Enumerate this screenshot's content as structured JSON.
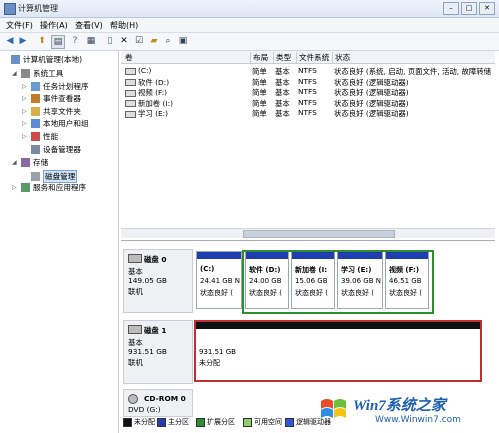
{
  "window": {
    "title": "计算机管理"
  },
  "menu": [
    "文件(F)",
    "操作(A)",
    "查看(V)",
    "帮助(H)"
  ],
  "tree": [
    {
      "label": "计算机管理(本地)",
      "icon": "computer-icon",
      "indent": 0,
      "expander": ""
    },
    {
      "label": "系统工具",
      "icon": "tools-icon",
      "indent": 1,
      "expander": "◢"
    },
    {
      "label": "任务计划程序",
      "icon": "clock-icon",
      "indent": 2,
      "expander": "▷"
    },
    {
      "label": "事件查看器",
      "icon": "log-icon",
      "indent": 2,
      "expander": "▷"
    },
    {
      "label": "共享文件夹",
      "icon": "folder-icon",
      "indent": 2,
      "expander": "▷"
    },
    {
      "label": "本地用户和组",
      "icon": "users-icon",
      "indent": 2,
      "expander": "▷"
    },
    {
      "label": "性能",
      "icon": "perf-icon",
      "indent": 2,
      "expander": "▷"
    },
    {
      "label": "设备管理器",
      "icon": "device-icon",
      "indent": 2,
      "expander": ""
    },
    {
      "label": "存储",
      "icon": "storage-icon",
      "indent": 1,
      "expander": "◢"
    },
    {
      "label": "磁盘管理",
      "icon": "disk-icon",
      "indent": 2,
      "expander": "",
      "selected": true
    },
    {
      "label": "服务和应用程序",
      "icon": "services-icon",
      "indent": 1,
      "expander": "▷"
    }
  ],
  "volumes": {
    "headers": [
      "卷",
      "布局",
      "类型",
      "文件系统",
      "状态"
    ],
    "rows": [
      [
        "(C:)",
        "简单",
        "基本",
        "NTFS",
        "状态良好 (系统, 启动, 页面文件, 活动, 故障转储"
      ],
      [
        "软件 (D:)",
        "简单",
        "基本",
        "NTFS",
        "状态良好 (逻辑驱动器)"
      ],
      [
        "视频 (F:)",
        "简单",
        "基本",
        "NTFS",
        "状态良好 (逻辑驱动器)"
      ],
      [
        "新加卷 (I:)",
        "简单",
        "基本",
        "NTFS",
        "状态良好 (逻辑驱动器)"
      ],
      [
        "学习 (E:)",
        "简单",
        "基本",
        "NTFS",
        "状态良好 (逻辑驱动器)"
      ]
    ]
  },
  "disks": [
    {
      "name": "磁盘 0",
      "type": "基本",
      "size": "149.05 GB",
      "status": "联机",
      "partitions": [
        {
          "title": "(C:)",
          "size": "24.41 GB N",
          "state": "状态良好 (",
          "bar": "#1f3fb0"
        },
        {
          "title": "软件 (D:)",
          "size": "24.00 GB",
          "state": "状态良好 (",
          "bar": "#1f3fb0"
        },
        {
          "title": "新加卷 (I:",
          "size": "15.06 GB",
          "state": "状态良好 (",
          "bar": "#1f3fb0"
        },
        {
          "title": "学习 (E:)",
          "size": "39.06 GB N",
          "state": "状态良好 (",
          "bar": "#1f3fb0"
        },
        {
          "title": "视频 (F:)",
          "size": "46.51 GB",
          "state": "状态良好 (",
          "bar": "#1f3fb0"
        }
      ]
    },
    {
      "name": "磁盘 1",
      "type": "基本",
      "size": "931.51 GB",
      "status": "联机",
      "partitions": [
        {
          "title": "",
          "size": "931.51 GB",
          "state": "未分配",
          "bar": "#111111"
        }
      ]
    },
    {
      "name": "CD-ROM 0",
      "type": "DVD (G:)",
      "size": "",
      "status": ""
    }
  ],
  "legend": [
    {
      "label": "未分配",
      "color": "#111111"
    },
    {
      "label": "主分区",
      "color": "#1f3fb0"
    },
    {
      "label": "扩展分区",
      "color": "#2f8f2f"
    },
    {
      "label": "可用空间",
      "color": "#8fd06a"
    },
    {
      "label": "逻辑驱动器",
      "color": "#3355dd"
    }
  ],
  "watermark": {
    "brand": "Win7系统之家",
    "url": "Www.Winwin7.com"
  }
}
